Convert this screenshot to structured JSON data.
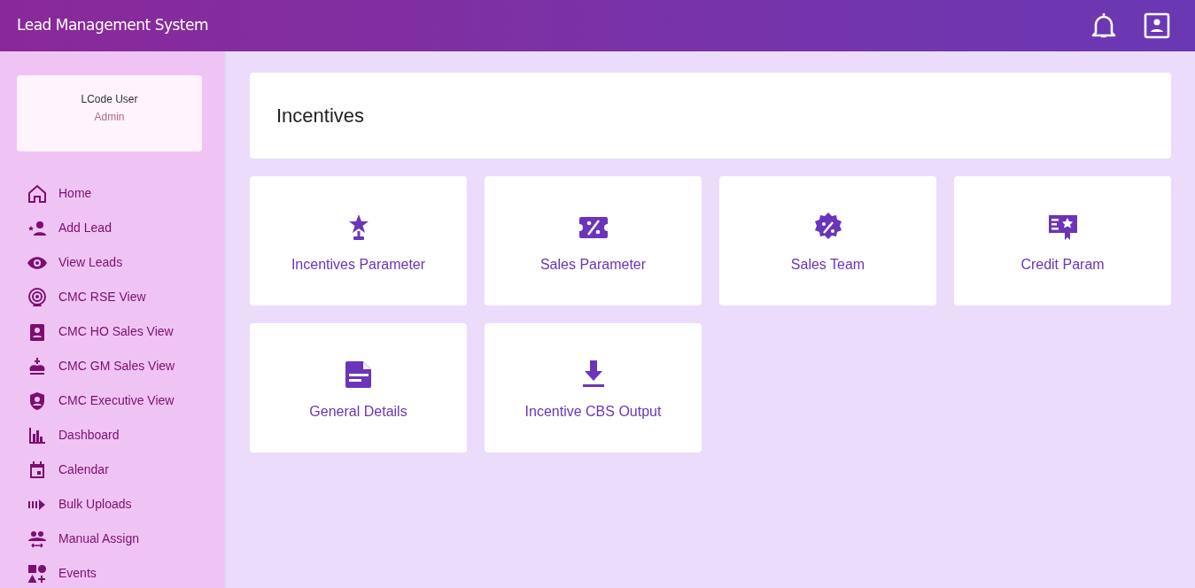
{
  "app_bar": {
    "title": "Lead Management System"
  },
  "user_card": {
    "name": "LCode User",
    "role": "Admin"
  },
  "sidebar": {
    "items": [
      {
        "label": "Home"
      },
      {
        "label": "Add Lead"
      },
      {
        "label": "View Leads"
      },
      {
        "label": "CMC RSE View"
      },
      {
        "label": "CMC HO Sales View"
      },
      {
        "label": "CMC GM Sales View"
      },
      {
        "label": "CMC Executive View"
      },
      {
        "label": "Dashboard"
      },
      {
        "label": "Calendar"
      },
      {
        "label": "Bulk Uploads"
      },
      {
        "label": "Manual Assign"
      },
      {
        "label": "Events"
      }
    ]
  },
  "page": {
    "title": "Incentives"
  },
  "tiles": [
    {
      "label": "Incentives Parameter"
    },
    {
      "label": "Sales Parameter"
    },
    {
      "label": "Sales Team"
    },
    {
      "label": "Credit Param"
    },
    {
      "label": "General Details"
    },
    {
      "label": "Incentive CBS Output"
    }
  ]
}
